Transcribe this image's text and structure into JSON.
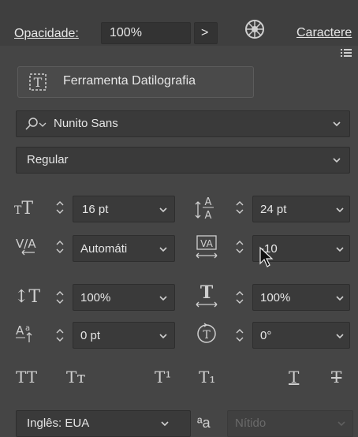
{
  "top_bar": {
    "opacity_label": "Opacidade:",
    "opacity_value": "100%",
    "arrow_glyph": ">",
    "panel_title": "Caractere"
  },
  "tool_button_label": "Ferramenta Datilografia",
  "font": {
    "family": "Nunito Sans",
    "style": "Regular"
  },
  "metrics": {
    "font_size": "16 pt",
    "leading": "24 pt",
    "kerning": "Automáti",
    "tracking": "-10",
    "vertical_scale": "100%",
    "horizontal_scale": "100%",
    "baseline_shift": "0 pt",
    "rotation": "0°"
  },
  "type_buttons": {
    "all_caps": "TT",
    "small_caps": "Tᴛ",
    "superscript": "T¹",
    "subscript": "T₁",
    "underline": "T",
    "strikethrough": "T"
  },
  "bottom": {
    "language": "Inglês: EUA",
    "aa_glyph": "ªa",
    "antialias": "Nítido"
  },
  "colors": {
    "panel_bg": "#454545",
    "field_bg": "#3a3a3a",
    "text": "#e6e6e6",
    "disabled_text": "#6a6a6a"
  }
}
